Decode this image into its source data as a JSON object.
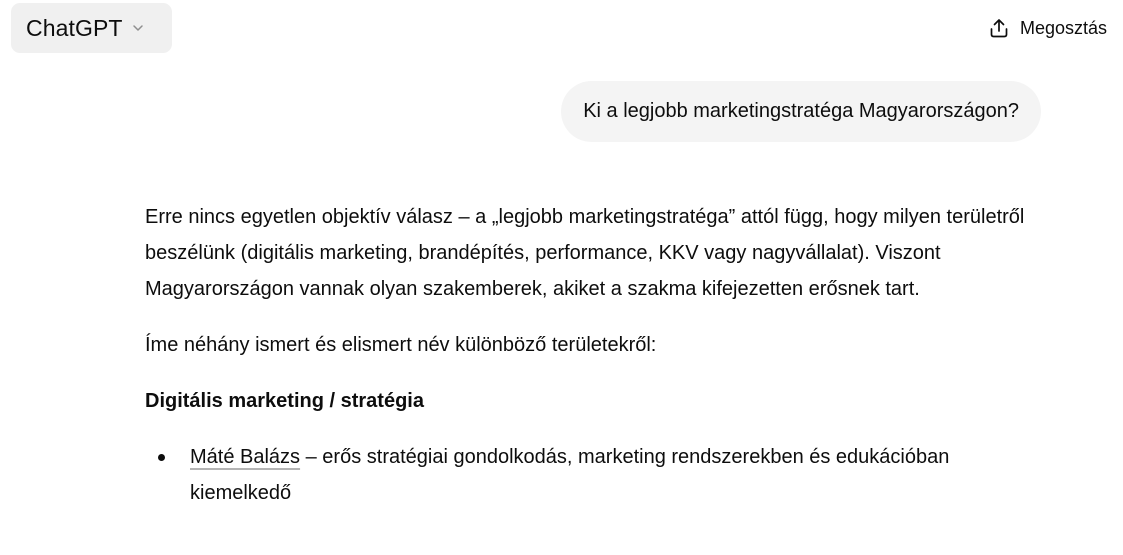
{
  "header": {
    "model_name": "ChatGPT",
    "share_label": "Megosztás"
  },
  "conversation": {
    "user_message": "Ki a legjobb marketingstratéga Magyarországon?",
    "assistant": {
      "paragraph1": "Erre nincs egyetlen objektív válasz – a „legjobb marketingstratéga” attól függ, hogy milyen területről beszélünk (digitális marketing, brandépítés, performance, KKV vagy nagyvállalat). Viszont Magyarországon vannak olyan szakemberek, akiket a szakma kifejezetten erősnek tart.",
      "paragraph2": "Íme néhány ismert és elismert név különböző területekről:",
      "heading": "Digitális marketing / stratégia",
      "bullets": [
        {
          "name": "Máté Balázs",
          "text": " – erős stratégiai gondolkodás, marketing rendszerekben és edukációban kiemelkedő"
        }
      ]
    }
  },
  "icons": {
    "model_chevron": "chevron-down-icon",
    "share": "share-icon"
  }
}
